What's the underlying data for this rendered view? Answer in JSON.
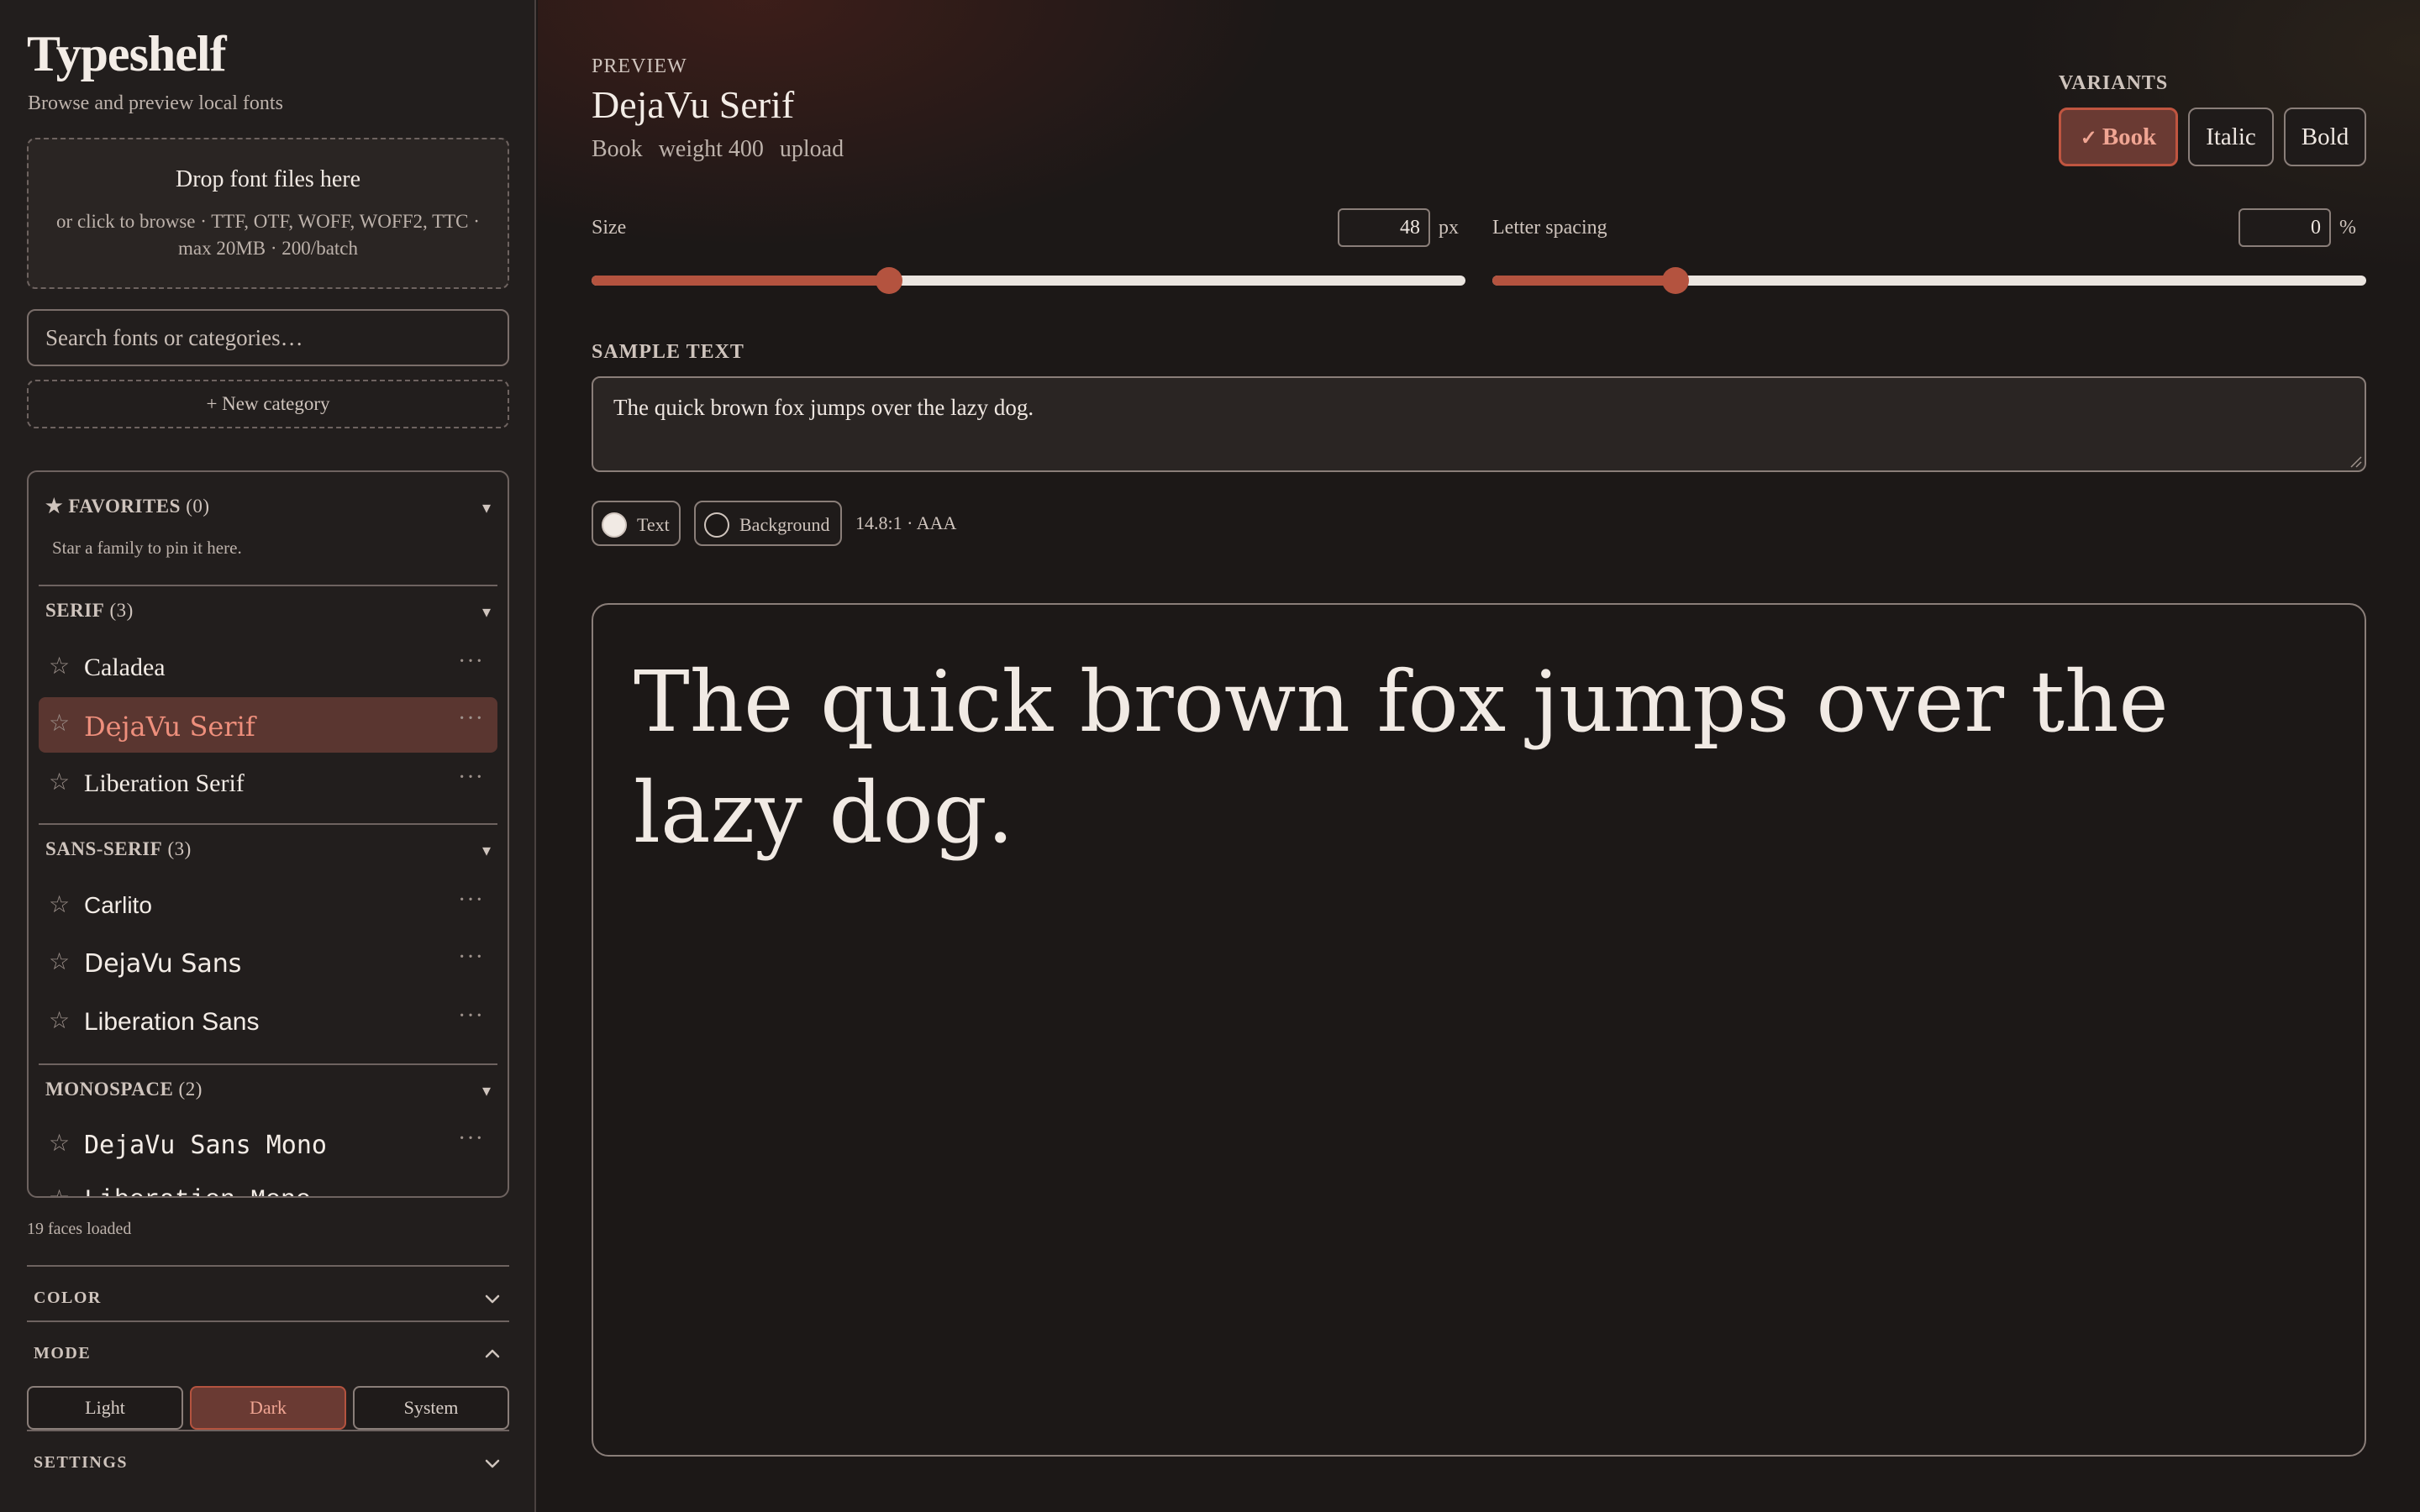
{
  "app": {
    "title": "Typeshelf",
    "subtitle": "Browse and preview local fonts"
  },
  "dropzone": {
    "title": "Drop font files here",
    "hint": "or click to browse · TTF, OTF, WOFF, WOFF2, TTC · max 20MB · 200/batch"
  },
  "search": {
    "placeholder": "Search fonts or categories…"
  },
  "new_category_label": "+ New category",
  "categories": {
    "favorites": {
      "star": "★",
      "label": "FAVORITES",
      "count": "(0)",
      "empty": "Star a family to pin it here."
    },
    "serif": {
      "label": "SERIF",
      "count": "(3)",
      "fonts": [
        "Caladea",
        "DejaVu Serif",
        "Liberation Serif"
      ]
    },
    "sans": {
      "label": "SANS-SERIF",
      "count": "(3)",
      "fonts": [
        "Carlito",
        "DejaVu Sans",
        "Liberation Sans"
      ]
    },
    "mono": {
      "label": "MONOSPACE",
      "count": "(2)",
      "fonts": [
        "DejaVu Sans Mono",
        "Liberation Mono"
      ]
    }
  },
  "glyphs": {
    "caret": "▾",
    "star": "☆",
    "more": "···",
    "check": "✓"
  },
  "faces_loaded": "19 faces loaded",
  "accordion": {
    "color": "COLOR",
    "mode": "MODE",
    "settings": "SETTINGS"
  },
  "mode": {
    "options": [
      "Light",
      "Dark",
      "System"
    ],
    "selected": "Dark"
  },
  "preview": {
    "eyebrow": "PREVIEW",
    "family": "DejaVu Serif",
    "meta": [
      "Book",
      "weight 400",
      "upload"
    ]
  },
  "variants": {
    "label": "VARIANTS",
    "options": [
      "Book",
      "Italic",
      "Bold"
    ],
    "selected": "Book"
  },
  "size": {
    "label": "Size",
    "value": "48",
    "unit": "px",
    "fraction": 0.34
  },
  "letter_spacing": {
    "label": "Letter spacing",
    "value": "0",
    "unit": "%",
    "fraction": 0.21
  },
  "sample": {
    "label": "SAMPLE TEXT",
    "text": "The quick brown fox jumps over the lazy dog."
  },
  "colors": {
    "text_label": "Text",
    "background_label": "Background",
    "contrast": "14.8:1 · AAA",
    "text_swatch": "#f1eae4",
    "background_swatch": "#1c1817",
    "accent": "#b4533f"
  }
}
